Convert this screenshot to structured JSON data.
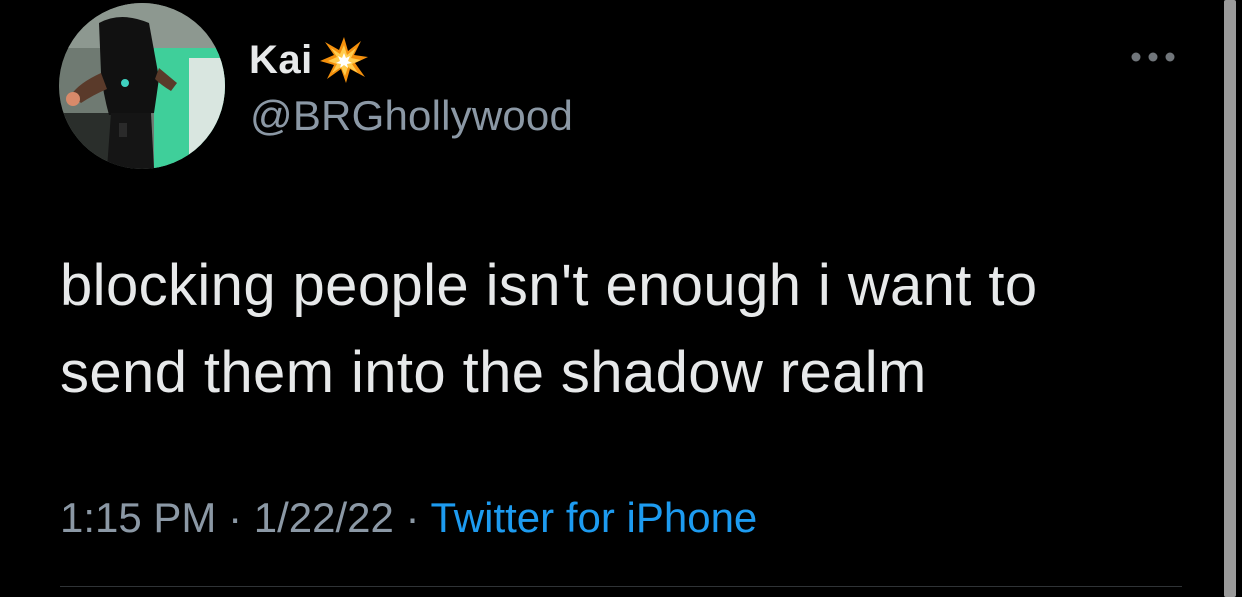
{
  "tweet": {
    "author": {
      "display_name": "Kai",
      "name_emoji": "collision-emoji",
      "handle": "@BRGhollywood",
      "avatar": "profile-photo"
    },
    "more_icon": "more-horizontal-icon",
    "text_line_1": "blocking people isn't enough i want to",
    "text_line_2": "send them into the shadow realm",
    "time": "1:15 PM",
    "separator": " · ",
    "date": "1/22/22",
    "source": "Twitter for iPhone"
  },
  "colors": {
    "background": "#000000",
    "primary_text": "#e7e9ea",
    "secondary_text": "#8b98a5",
    "link": "#1d9bf0",
    "divider": "#2f3336"
  }
}
